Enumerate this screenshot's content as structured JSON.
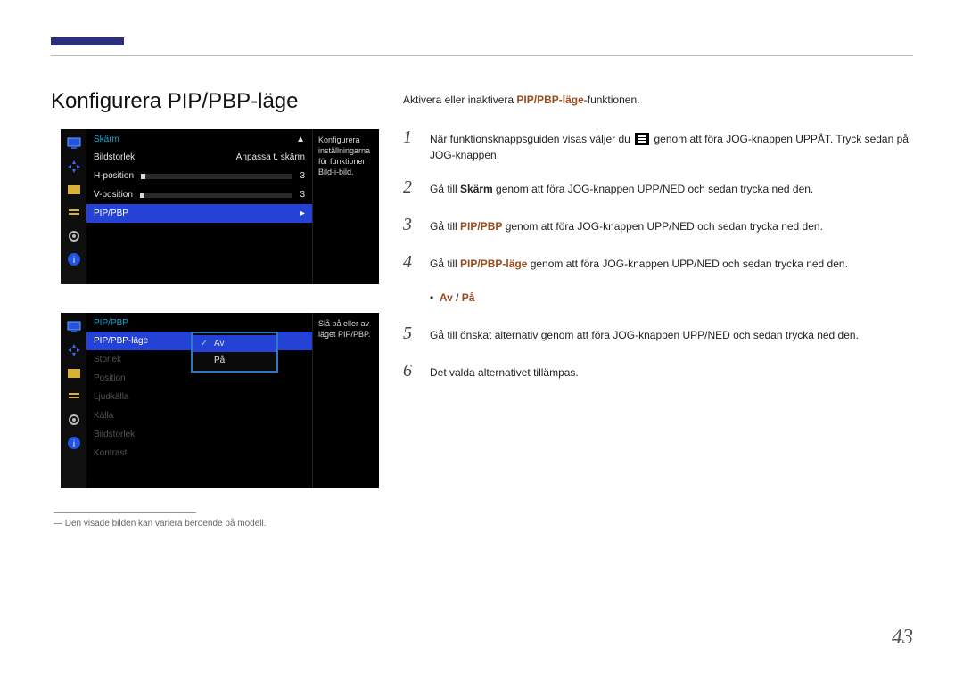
{
  "page": {
    "title": "Konfigurera PIP/PBP-läge",
    "number": "43"
  },
  "osd1": {
    "header": "Skärm",
    "arrow": "▲",
    "rows": {
      "bildstorlek": {
        "label": "Bildstorlek",
        "value": "Anpassa t. skärm"
      },
      "hpos": {
        "label": "H-position",
        "value": "3"
      },
      "vpos": {
        "label": "V-position",
        "value": "3"
      },
      "pip": {
        "label": "PIP/PBP",
        "chevron": "▸"
      }
    },
    "help": "Konfigurera inställningarna för funktionen Bild-i-bild."
  },
  "osd2": {
    "header": "PIP/PBP",
    "rows": {
      "mode": {
        "label": "PIP/PBP-läge"
      },
      "storlek": {
        "label": "Storlek"
      },
      "position": {
        "label": "Position"
      },
      "ljud": {
        "label": "Ljudkälla"
      },
      "kalla": {
        "label": "Källa"
      },
      "bildstorlek": {
        "label": "Bildstorlek"
      },
      "kontrast": {
        "label": "Kontrast"
      }
    },
    "popup": {
      "av": "Av",
      "pa": "På"
    },
    "help": "Slå på eller av läget PIP/PBP."
  },
  "footnote": "― Den visade bilden kan variera beroende på modell.",
  "right": {
    "intro_pre": "Aktivera eller inaktivera ",
    "intro_hl": "PIP/PBP-läge",
    "intro_post": "-funktionen.",
    "steps": {
      "s1": {
        "num": "1",
        "pre": "När funktionsknappsguiden visas väljer du ",
        "post": " genom att föra JOG-knappen UPPÅT. Tryck sedan på JOG-knappen."
      },
      "s2": {
        "num": "2",
        "pre": "Gå till ",
        "hl": "Skärm",
        "post": " genom att föra JOG-knappen UPP/NED och sedan trycka ned den."
      },
      "s3": {
        "num": "3",
        "pre": "Gå till ",
        "hl": "PIP/PBP",
        "post": " genom att föra JOG-knappen UPP/NED och sedan trycka ned den."
      },
      "s4": {
        "num": "4",
        "pre": "Gå till ",
        "hl": "PIP/PBP-läge",
        "post": " genom att föra JOG-knappen UPP/NED och sedan trycka ned den."
      },
      "bullet": {
        "dot": "•",
        "hl": "Av",
        "sep": " / ",
        "hl2": "På"
      },
      "s5": {
        "num": "5",
        "text": "Gå till önskat alternativ genom att föra JOG-knappen UPP/NED och sedan trycka ned den."
      },
      "s6": {
        "num": "6",
        "text": "Det valda alternativet tillämpas."
      }
    }
  }
}
